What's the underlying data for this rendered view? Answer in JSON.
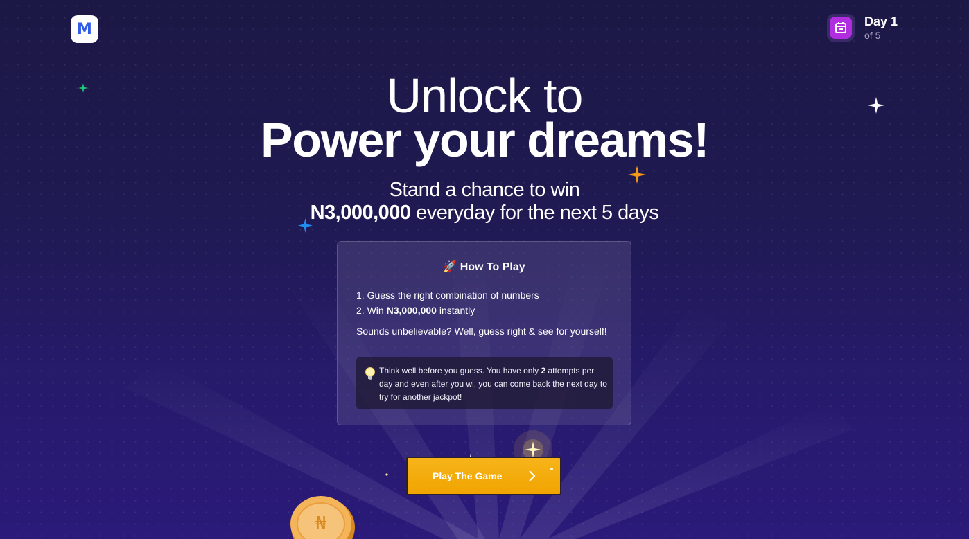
{
  "logo": {
    "letter": "M"
  },
  "day_badge": {
    "title": "Day 1",
    "subtitle": "of 5",
    "icon": "calendar-icon",
    "color": "#b02ee0"
  },
  "hero": {
    "line1": "Unlock to",
    "line2": "Power your dreams!",
    "sub_line1": "Stand a chance to win",
    "sub_amount": "N3,000,000",
    "sub_rest": " everyday for the next 5 days"
  },
  "how_to_play": {
    "title": "🚀 How To Play",
    "step1": "1. Guess the right combination of numbers",
    "step2_prefix": "2. Win ",
    "step2_amount": "N3,000,000",
    "step2_suffix": " instantly",
    "note": "Sounds unbelievable? Well, guess right & see for yourself!",
    "tip_prefix": "Think well before you guess. You have only ",
    "tip_attempts": "2",
    "tip_suffix": " attempts per day and even after you wi, you can come back the next day to try for another jackpot!",
    "tip_icon": "lightbulb-icon"
  },
  "cta": {
    "label": "Play The Game",
    "icon": "chevron-right-icon",
    "color": "#f5ac0a"
  },
  "colors": {
    "background": "#1f1a52",
    "accent": "#f5ac0a"
  }
}
